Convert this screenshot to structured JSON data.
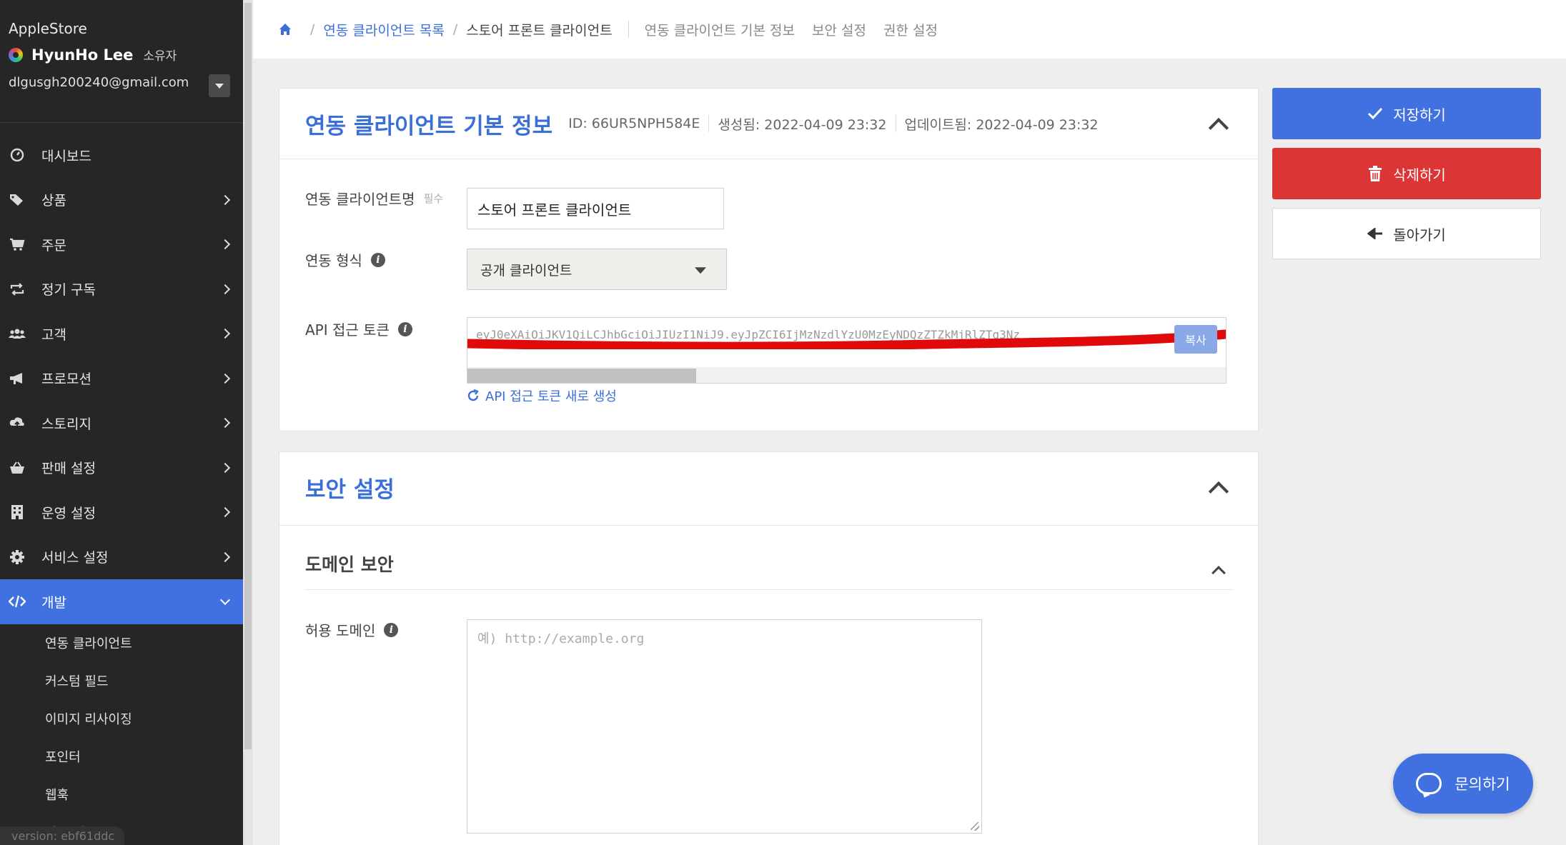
{
  "sidebar": {
    "store_name": "AppleStore",
    "user_name": "HyunHo Lee",
    "user_role": "소유자",
    "email": "dlgusgh200240@gmail.com",
    "items": [
      {
        "label": "대시보드",
        "icon": "dashboard-icon",
        "has_children": false
      },
      {
        "label": "상품",
        "icon": "tag-icon",
        "has_children": true
      },
      {
        "label": "주문",
        "icon": "cart-icon",
        "has_children": true
      },
      {
        "label": "정기 구독",
        "icon": "repeat-icon",
        "has_children": true
      },
      {
        "label": "고객",
        "icon": "users-icon",
        "has_children": true
      },
      {
        "label": "프로모션",
        "icon": "megaphone-icon",
        "has_children": true
      },
      {
        "label": "스토리지",
        "icon": "cloud-upload-icon",
        "has_children": true
      },
      {
        "label": "판매 설정",
        "icon": "basket-icon",
        "has_children": true
      },
      {
        "label": "운영 설정",
        "icon": "building-icon",
        "has_children": true
      },
      {
        "label": "서비스 설정",
        "icon": "gear-icon",
        "has_children": true
      },
      {
        "label": "개발",
        "icon": "code-icon",
        "has_children": true,
        "active": true
      }
    ],
    "sub_items": [
      "연동 클라이언트",
      "커스텀 필드",
      "이미지 리사이징",
      "포인터",
      "웹훅",
      "외부 연동"
    ],
    "version": "version: ebf61ddc"
  },
  "header": {
    "breadcrumb_link": "연동 클라이언트 목록",
    "breadcrumb_current": "스토어 프론트 클라이언트",
    "anchors": [
      "연동 클라이언트 기본 정보",
      "보안 설정",
      "권한 설정"
    ]
  },
  "basic_info": {
    "title": "연동 클라이언트 기본 정보",
    "id": "ID: 66UR5NPH584E",
    "created": "생성됨: 2022-04-09 23:32",
    "updated": "업데이트됨: 2022-04-09 23:32",
    "name_label": "연동 클라이언트명",
    "required": "필수",
    "name_value": "스토어 프론트 클라이언트",
    "type_label": "연동 형식",
    "type_value": "공개 클라이언트",
    "token_label": "API 접근 토큰",
    "token_value": "eyJ0eXAiOiJKV1QiLCJhbGciOiJIUzI1NiJ9.eyJpZCI6IjMzNzdlYzU0MzEyNDQzZTZkMjRlZTg3Nz",
    "copy_label": "복사",
    "regen_label": "API 접근 토큰 새로 생성"
  },
  "security": {
    "title": "보안 설정",
    "domain_section_title": "도메인 보안",
    "allowed_domain_label": "허용 도메인",
    "allowed_domain_placeholder": "예) http://example.org"
  },
  "actions": {
    "save": "저장하기",
    "delete": "삭제하기",
    "back": "돌아가기"
  },
  "chat": {
    "label": "문의하기"
  },
  "colors": {
    "primary": "#4170e0",
    "danger": "#dc3535",
    "sidebar_bg": "#262626"
  }
}
